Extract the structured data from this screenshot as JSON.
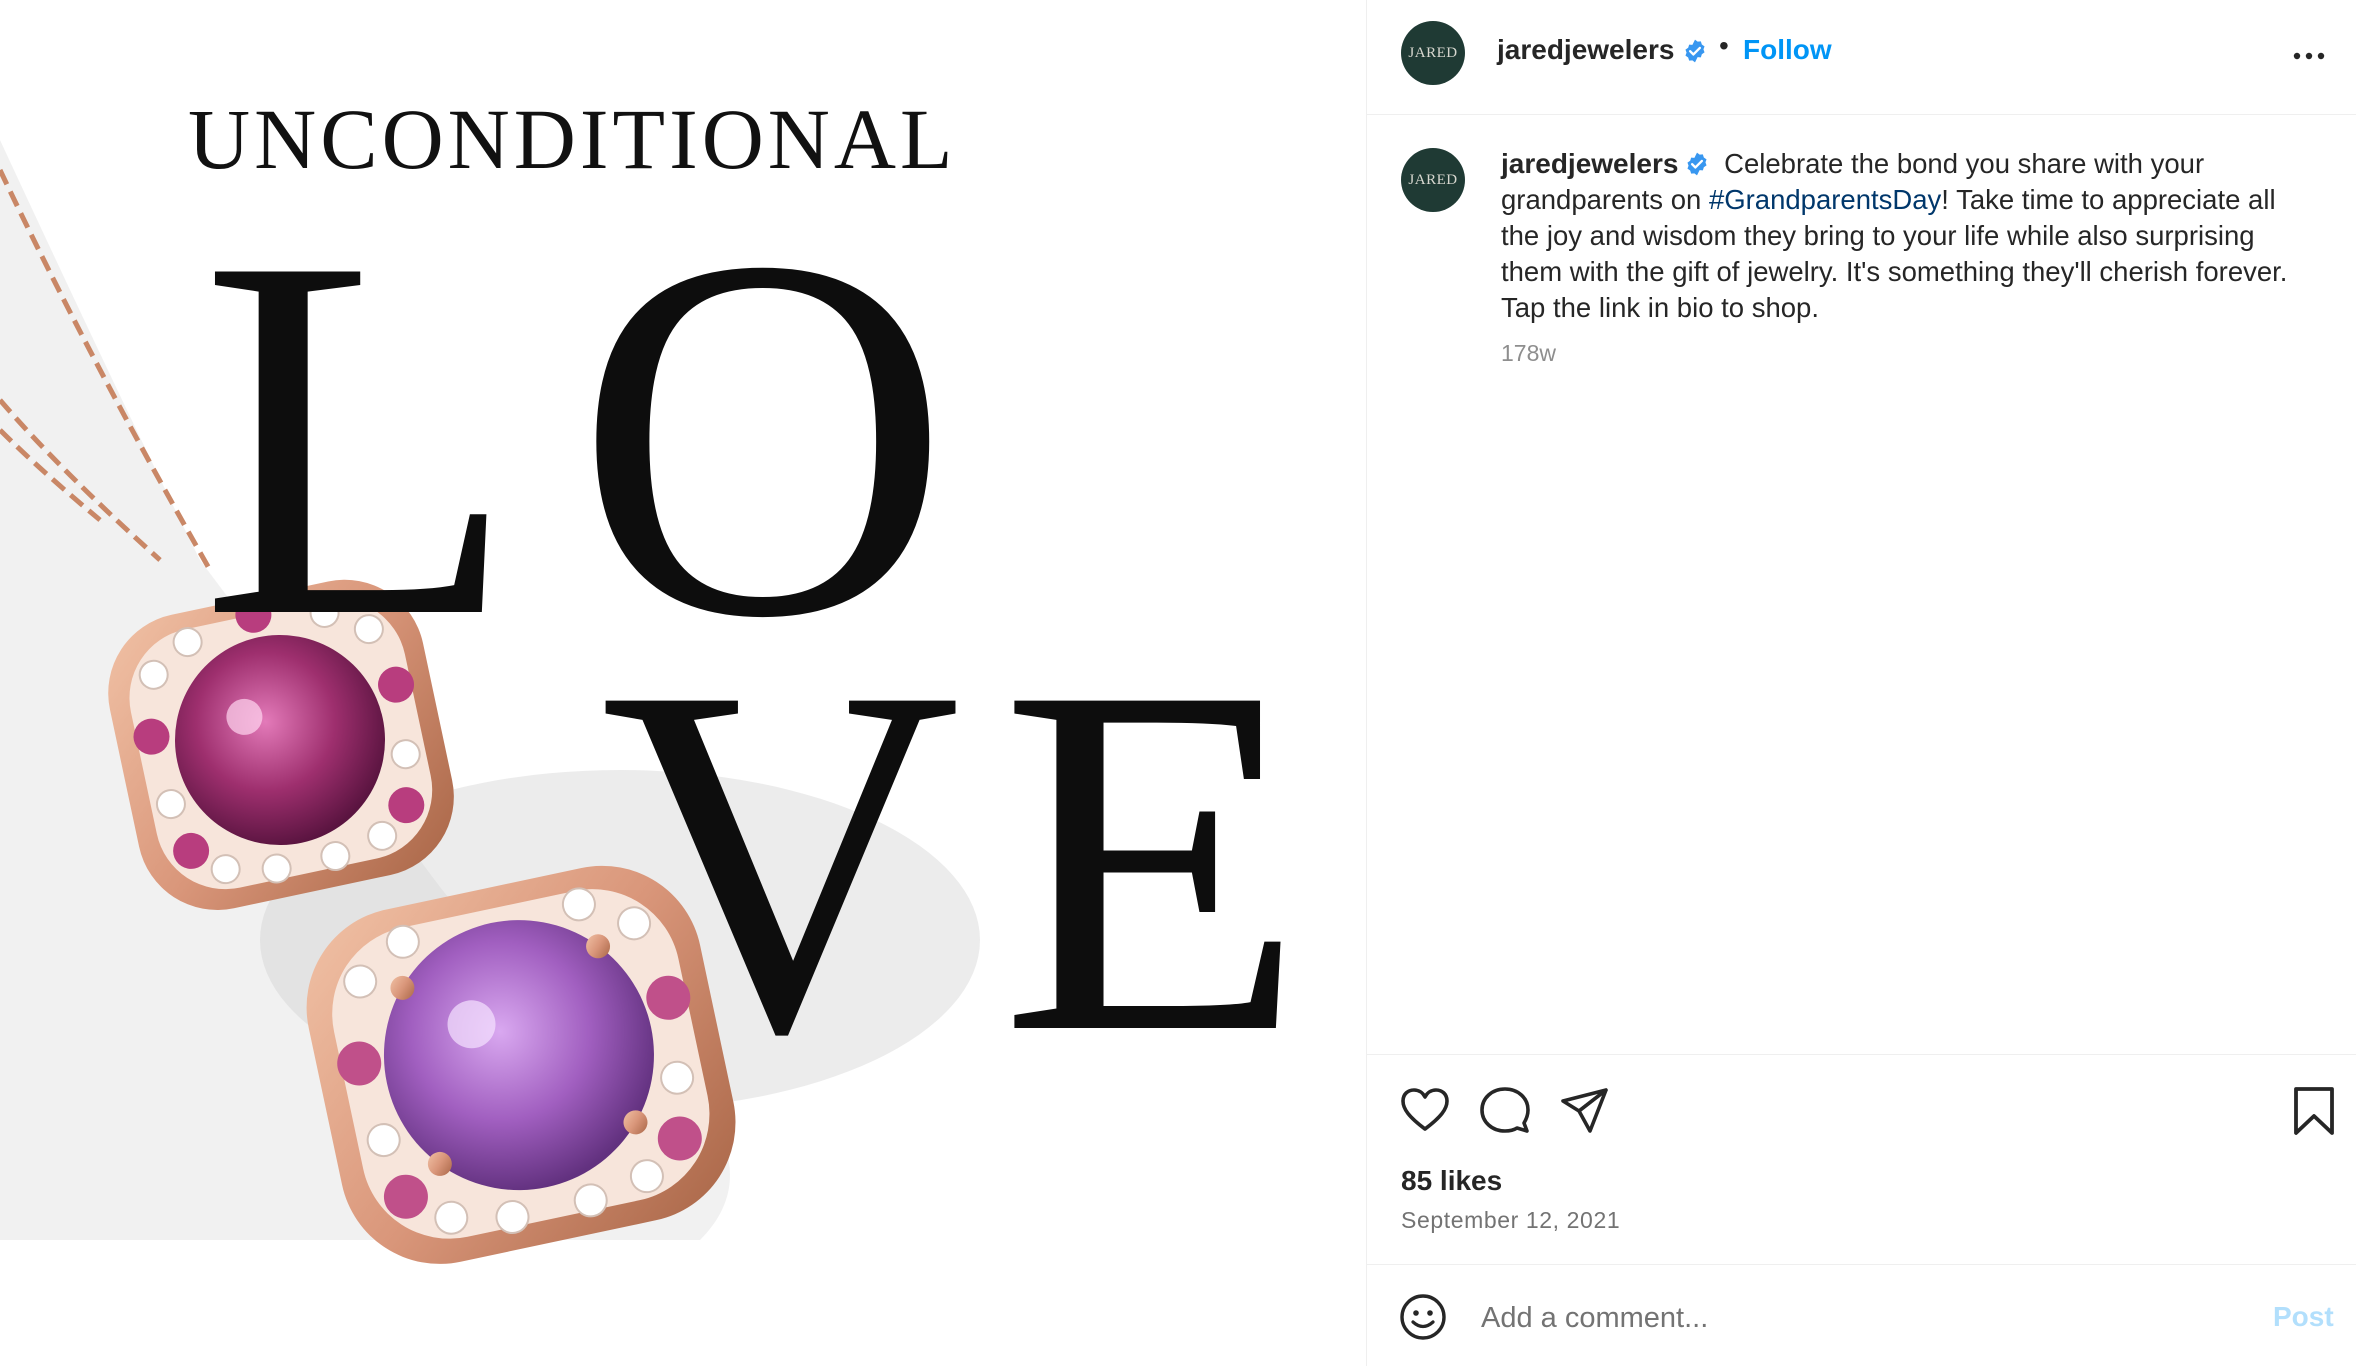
{
  "media": {
    "headline_small": "UNCONDITIONAL",
    "letters": [
      "L",
      "O",
      "V",
      "E"
    ]
  },
  "header": {
    "avatar_text": "JARED",
    "username": "jaredjewelers",
    "separator": "•",
    "follow_label": "Follow",
    "more_icon": "more-horizontal-icon"
  },
  "caption": {
    "avatar_text": "JARED",
    "username": "jaredjewelers",
    "text_before": " Celebrate the bond you share with your grandparents on ",
    "hashtag": "#GrandparentsDay",
    "text_after": "! Take time to appreciate all the joy and wisdom they bring to your life while also surprising them with the gift of jewelry. It's something they'll cherish forever. Tap the link in bio to shop.",
    "timestamp": "178w"
  },
  "actions": {
    "icons": [
      "heart-icon",
      "comment-icon",
      "share-icon",
      "bookmark-icon"
    ],
    "likes": "85 likes",
    "date": "September 12, 2021"
  },
  "comment_bar": {
    "emoji_icon": "emoji-icon",
    "placeholder": "Add a comment...",
    "post_label": "Post"
  },
  "colors": {
    "accent": "#0095f6",
    "hashtag": "#00376b",
    "verified": "#3897f0",
    "post_disabled": "#b2dffc",
    "rose_gold": "#d9967a",
    "amethyst": "#a15fc0",
    "rhodolite": "#9e2f6e"
  }
}
